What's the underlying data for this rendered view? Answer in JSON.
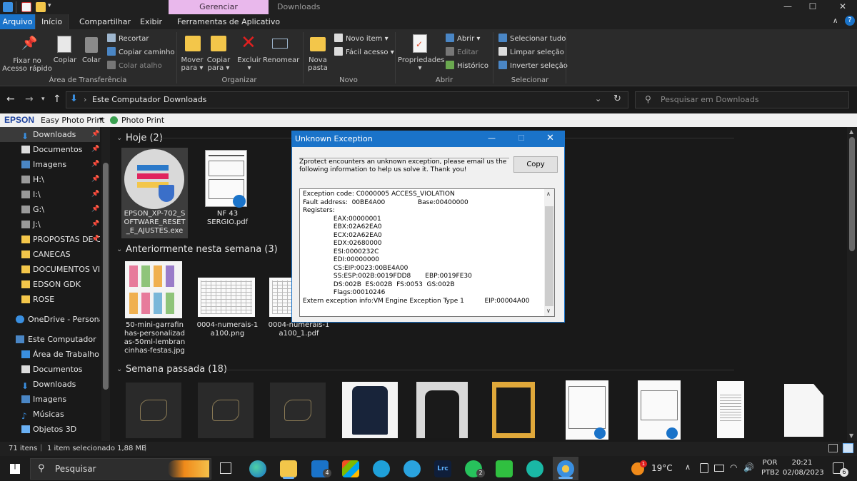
{
  "titlebar": {
    "context_tab": "Gerenciar",
    "window_title": "Downloads",
    "minimize": "—",
    "maximize": "☐",
    "close": "✕"
  },
  "tabs": [
    "Arquivo",
    "Início",
    "Compartilhar",
    "Exibir",
    "Ferramentas de Aplicativo"
  ],
  "ribbon": {
    "pin_label_1": "Fixar no",
    "pin_label_2": "Acesso rápido",
    "copy": "Copiar",
    "paste": "Colar",
    "cut": "Recortar",
    "copy_path": "Copiar caminho",
    "paste_shortcut": "Colar atalho",
    "clipboard_group": "Área de Transferência",
    "move_1": "Mover",
    "move_2": "para ▾",
    "copyto_1": "Copiar",
    "copyto_2": "para ▾",
    "delete": "Excluir",
    "delete_2": "▾",
    "rename": "Renomear",
    "organize_group": "Organizar",
    "new_folder_1": "Nova",
    "new_folder_2": "pasta",
    "new_item": "Novo item ▾",
    "easy_access": "Fácil acesso ▾",
    "new_group": "Novo",
    "properties": "Propriedades",
    "properties_2": "▾",
    "open": "Abrir ▾",
    "edit": "Editar",
    "history": "Histórico",
    "open_group": "Abrir",
    "select_all": "Selecionar tudo",
    "clear_selection": "Limpar seleção",
    "invert_selection": "Inverter seleção",
    "select_group": "Selecionar"
  },
  "address": {
    "root": "Este Computador",
    "separator": "›",
    "current": "Downloads",
    "search_placeholder": "Pesquisar em Downloads"
  },
  "epson_bar": {
    "brand": "EPSON",
    "easy_photo": "Easy Photo Print",
    "dropdown": "▾",
    "photo_print": "Photo Print"
  },
  "nav": {
    "items": [
      {
        "label": "Downloads",
        "pinned": true
      },
      {
        "label": "Documentos",
        "pinned": true
      },
      {
        "label": "Imagens",
        "pinned": true
      },
      {
        "label": "H:\\",
        "pinned": true
      },
      {
        "label": "I:\\",
        "pinned": true
      },
      {
        "label": "G:\\",
        "pinned": true
      },
      {
        "label": "J:\\",
        "pinned": true
      },
      {
        "label": "PROPOSTAS DE C",
        "pinned": true
      },
      {
        "label": "CANECAS",
        "pinned": false
      },
      {
        "label": "DOCUMENTOS VIAN",
        "pinned": false
      },
      {
        "label": "EDSON GDK",
        "pinned": false
      },
      {
        "label": "ROSE",
        "pinned": false
      }
    ],
    "onedrive": "OneDrive - Personal",
    "this_pc": "Este Computador",
    "pc_items": [
      "Área de Trabalho",
      "Documentos",
      "Downloads",
      "Imagens",
      "Músicas",
      "Objetos 3D"
    ]
  },
  "groups": {
    "today": "Hoje (2)",
    "earlier": "Anteriormente nesta semana (3)",
    "last_week": "Semana passada (18)"
  },
  "files_today": [
    {
      "name_1": "EPSON_XP-702_S",
      "name_2": "OFTWARE_RESET",
      "name_3": "_E_AJUSTES.exe"
    },
    {
      "name_1": "NF 43",
      "name_2": "SERGIO.pdf",
      "name_3": ""
    }
  ],
  "files_earlier": [
    {
      "name_1": "50-mini-garrafin",
      "name_2": "has-personalizad",
      "name_3": "as-50ml-lembran",
      "name_4": "cinhas-festas.jpg"
    },
    {
      "name_1": "0004-numerais-1",
      "name_2": "a100.png",
      "name_3": "",
      "name_4": ""
    },
    {
      "name_1": "0004-numerais-1",
      "name_2": "a100_1.pdf",
      "name_3": "",
      "name_4": ""
    }
  ],
  "dialog": {
    "title": "Unknown Exception",
    "message_1": "Zprotect encounters an unknown exception, please email us the",
    "message_2": "following information to help us solve it. Thank you!",
    "copy_button": "Copy",
    "details": "Exception code: C0000005 ACCESS_VIOLATION\nFault address:  00BE4A00                Base:00400000\nRegisters:\n               EAX:00000001\n               EBX:02A62EA0\n               ECX:02A62EA0\n               EDX:02680000\n               ESI:0000232C\n               EDI:00000000\n               CS:EIP:0023:00BE4A00\n               SS:ESP:002B:0019FDD8       EBP:0019FE30\n               DS:002B  ES:002B  FS:0053  GS:002B\n               Flags:00010246\nExtern exception info:VM Engine Exception Type 1          EIP:00004A00"
  },
  "status": {
    "items": "71 itens",
    "selected": "1 item selecionado  1,88 MB"
  },
  "taskbar": {
    "search": "Pesquisar",
    "weather": "19°C",
    "lang_1": "POR",
    "lang_2": "PTB2",
    "time": "20:21",
    "date": "02/08/2023",
    "mail_badge": "4",
    "whatsapp_badge": "2",
    "notif_count": "6",
    "weather_badge": "1"
  }
}
